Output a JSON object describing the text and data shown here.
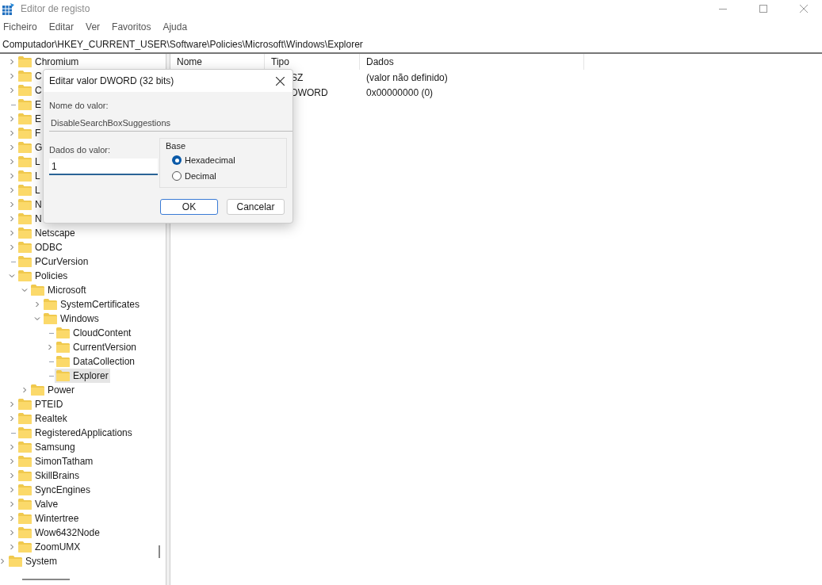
{
  "window": {
    "title": "Editor de registo"
  },
  "menu": [
    "Ficheiro",
    "Editar",
    "Ver",
    "Favoritos",
    "Ajuda"
  ],
  "address": "Computador\\HKEY_CURRENT_USER\\Software\\Policies\\Microsoft\\Windows\\Explorer",
  "tree": {
    "items": [
      {
        "label": "Chromium",
        "expandable": true,
        "expanded": false,
        "selected": false
      },
      {
        "label": "C",
        "expandable": true,
        "expanded": false,
        "selected": false
      },
      {
        "label": "C",
        "expandable": true,
        "expanded": false,
        "selected": false
      },
      {
        "label": "E",
        "expandable": false,
        "selected": false
      },
      {
        "label": "E",
        "expandable": true,
        "expanded": false,
        "selected": false
      },
      {
        "label": "F",
        "expandable": true,
        "expanded": false,
        "selected": false
      },
      {
        "label": "G",
        "expandable": true,
        "expanded": false,
        "selected": false
      },
      {
        "label": "L",
        "expandable": true,
        "expanded": false,
        "selected": false
      },
      {
        "label": "L",
        "expandable": true,
        "expanded": false,
        "selected": false
      },
      {
        "label": "L",
        "expandable": true,
        "expanded": false,
        "selected": false
      },
      {
        "label": "N",
        "expandable": true,
        "expanded": false,
        "selected": false
      },
      {
        "label": "N",
        "expandable": true,
        "expanded": false,
        "selected": false
      },
      {
        "label": "Netscape",
        "expandable": true,
        "expanded": false,
        "selected": false
      },
      {
        "label": "ODBC",
        "expandable": true,
        "expanded": false,
        "selected": false
      },
      {
        "label": "PCurVersion",
        "expandable": false,
        "selected": false
      },
      {
        "label": "Policies",
        "expandable": true,
        "expanded": true,
        "selected": false,
        "children": [
          {
            "label": "Microsoft",
            "expandable": true,
            "expanded": true,
            "selected": false,
            "children": [
              {
                "label": "SystemCertificates",
                "expandable": true,
                "expanded": false,
                "selected": false
              },
              {
                "label": "Windows",
                "expandable": true,
                "expanded": true,
                "selected": false,
                "children": [
                  {
                    "label": "CloudContent",
                    "expandable": false,
                    "selected": false
                  },
                  {
                    "label": "CurrentVersion",
                    "expandable": true,
                    "expanded": false,
                    "selected": false
                  },
                  {
                    "label": "DataCollection",
                    "expandable": false,
                    "selected": false
                  },
                  {
                    "label": "Explorer",
                    "expandable": false,
                    "selected": true
                  }
                ]
              }
            ]
          },
          {
            "label": "Power",
            "expandable": true,
            "expanded": false,
            "selected": false
          }
        ]
      },
      {
        "label": "PTEID",
        "expandable": true,
        "expanded": false,
        "selected": false
      },
      {
        "label": "Realtek",
        "expandable": true,
        "expanded": false,
        "selected": false
      },
      {
        "label": "RegisteredApplications",
        "expandable": false,
        "selected": false
      },
      {
        "label": "Samsung",
        "expandable": true,
        "expanded": false,
        "selected": false
      },
      {
        "label": "SimonTatham",
        "expandable": true,
        "expanded": false,
        "selected": false
      },
      {
        "label": "SkillBrains",
        "expandable": true,
        "expanded": false,
        "selected": false
      },
      {
        "label": "SyncEngines",
        "expandable": true,
        "expanded": false,
        "selected": false
      },
      {
        "label": "Valve",
        "expandable": true,
        "expanded": false,
        "selected": false
      },
      {
        "label": "Wintertree",
        "expandable": true,
        "expanded": false,
        "selected": false
      },
      {
        "label": "Wow6432Node",
        "expandable": true,
        "expanded": false,
        "selected": false
      },
      {
        "label": "ZoomUMX",
        "expandable": true,
        "expanded": false,
        "selected": false
      }
    ],
    "parent_siblings": [
      {
        "label": "System",
        "expandable": true,
        "expanded": false,
        "selected": false
      }
    ]
  },
  "values": {
    "columns": [
      "Nome",
      "Tipo",
      "Dados"
    ],
    "rows": [
      {
        "tipo": "SZ",
        "dados": "(valor não definido)"
      },
      {
        "tipo": "DWORD",
        "dados": "0x00000000 (0)"
      }
    ]
  },
  "dialog": {
    "title": "Editar valor DWORD (32 bits)",
    "name_label": "Nome do valor:",
    "name_value": "DisableSearchBoxSuggestions",
    "data_label": "Dados do valor:",
    "data_value": "1",
    "base_label": "Base",
    "bases": [
      {
        "label": "Hexadecimal",
        "selected": true
      },
      {
        "label": "Decimal",
        "selected": false
      }
    ],
    "buttons": [
      {
        "label": "OK",
        "default": true
      },
      {
        "label": "Cancelar",
        "default": false
      }
    ]
  }
}
